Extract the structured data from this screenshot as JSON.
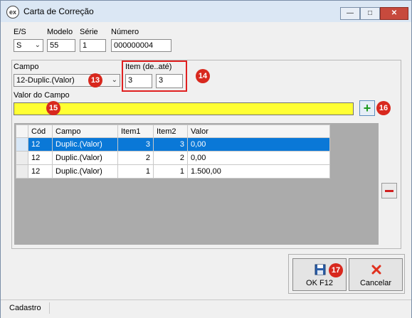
{
  "window": {
    "title": "Carta de Correção",
    "icon_text": "ex"
  },
  "labels": {
    "es": "E/S",
    "modelo": "Modelo",
    "serie": "Série",
    "numero": "Número",
    "campo": "Campo",
    "item": "Item (de..até)",
    "valor": "Valor do Campo"
  },
  "fields": {
    "es": "S",
    "modelo": "55",
    "serie": "1",
    "numero": "000000004",
    "campo": "12-Duplic.(Valor)",
    "item_de": "3",
    "item_ate": "3",
    "valor": ""
  },
  "badges": {
    "b13": "13",
    "b14": "14",
    "b15": "15",
    "b16": "16",
    "b17": "17"
  },
  "grid": {
    "headers": [
      "Cód",
      "Campo",
      "Item1",
      "Item2",
      "Valor"
    ],
    "rows": [
      [
        "12",
        "Duplic.(Valor)",
        "3",
        "3",
        "0,00"
      ],
      [
        "12",
        "Duplic.(Valor)",
        "2",
        "2",
        "0,00"
      ],
      [
        "12",
        "Duplic.(Valor)",
        "1",
        "1",
        "1.500,00"
      ]
    ]
  },
  "buttons": {
    "ok": "OK  F12",
    "cancel": "Cancelar"
  },
  "status": {
    "tab": "Cadastro"
  },
  "colors": {
    "highlight_field": "#ffff33",
    "selection": "#0a78d7",
    "badge": "#d8281e"
  },
  "icons": {
    "add": "plus-icon",
    "remove": "minus-icon",
    "save": "floppy-disk-icon",
    "cancel": "x-icon"
  }
}
